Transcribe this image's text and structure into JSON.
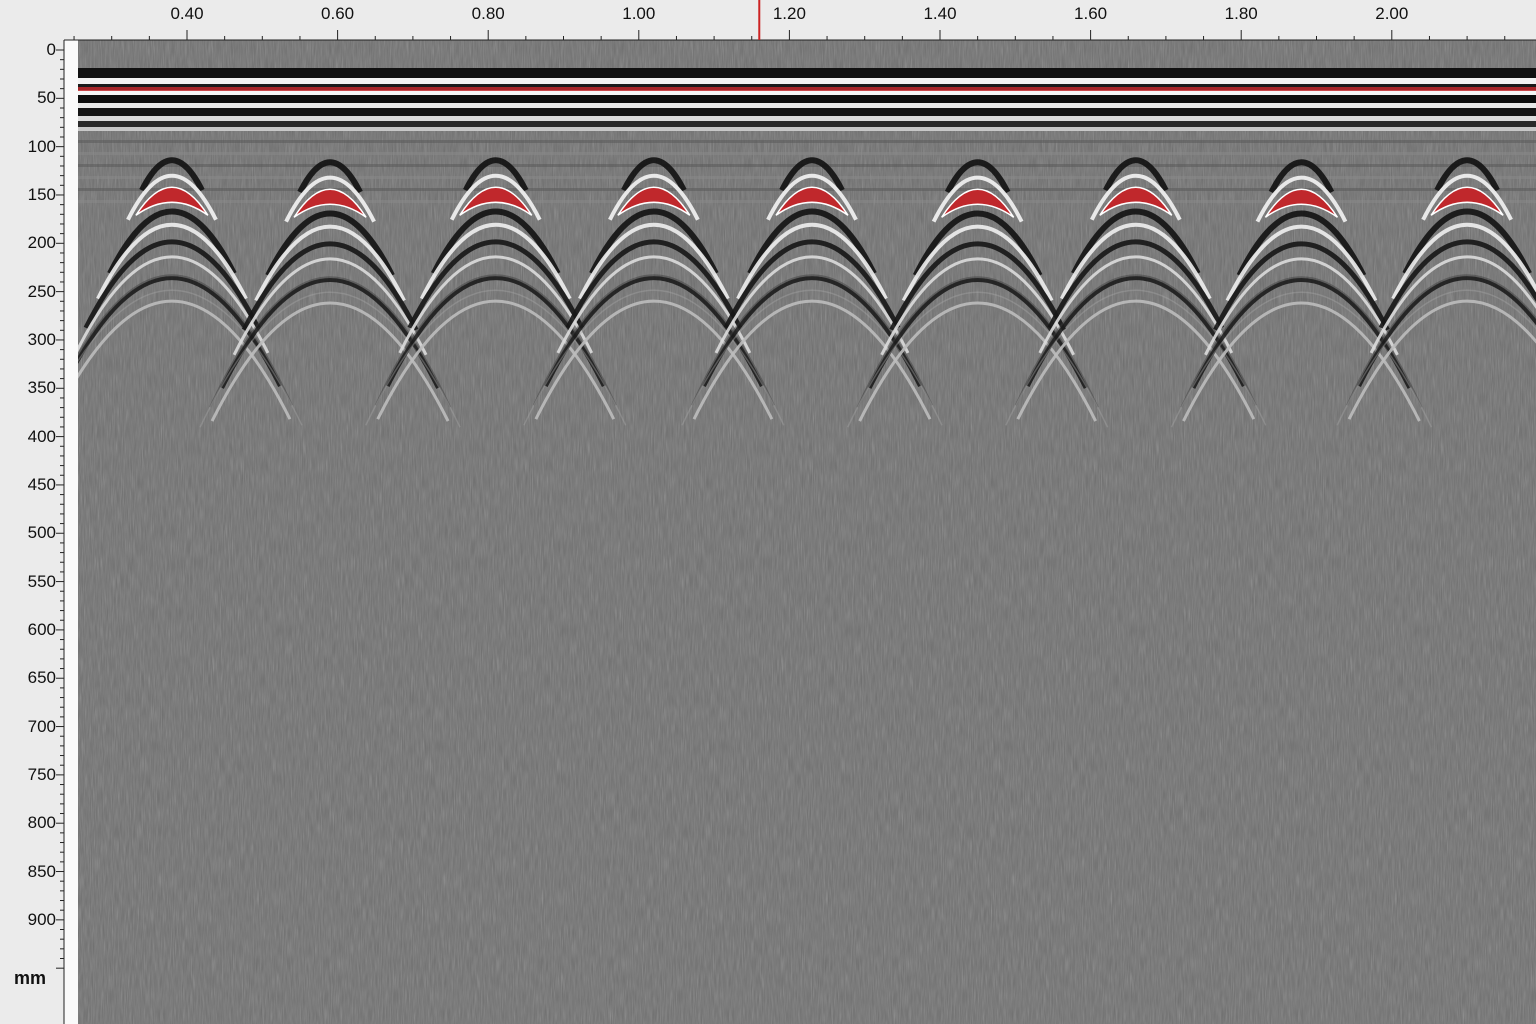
{
  "x_axis": {
    "ticks": [
      {
        "value": 0.4,
        "label": "0.40"
      },
      {
        "value": 0.6,
        "label": "0.60"
      },
      {
        "value": 0.8,
        "label": "0.80"
      },
      {
        "value": 1.0,
        "label": "1.00"
      },
      {
        "value": 1.2,
        "label": "1.20"
      },
      {
        "value": 1.4,
        "label": "1.40"
      },
      {
        "value": 1.6,
        "label": "1.60"
      },
      {
        "value": 1.8,
        "label": "1.80"
      },
      {
        "value": 2.0,
        "label": "2.00"
      }
    ],
    "cursor_value": 1.16
  },
  "y_axis": {
    "unit": "mm",
    "ticks": [
      {
        "value": 0,
        "label": "0"
      },
      {
        "value": 50,
        "label": "50"
      },
      {
        "value": 100,
        "label": "100"
      },
      {
        "value": 150,
        "label": "150"
      },
      {
        "value": 200,
        "label": "200"
      },
      {
        "value": 250,
        "label": "250"
      },
      {
        "value": 300,
        "label": "300"
      },
      {
        "value": 350,
        "label": "350"
      },
      {
        "value": 400,
        "label": "400"
      },
      {
        "value": 450,
        "label": "450"
      },
      {
        "value": 500,
        "label": "500"
      },
      {
        "value": 550,
        "label": "550"
      },
      {
        "value": 600,
        "label": "600"
      },
      {
        "value": 650,
        "label": "650"
      },
      {
        "value": 700,
        "label": "700"
      },
      {
        "value": 750,
        "label": "750"
      },
      {
        "value": 800,
        "label": "800"
      },
      {
        "value": 850,
        "label": "850"
      },
      {
        "value": 900,
        "label": "900"
      }
    ]
  },
  "targets": [
    {
      "x": 0.38,
      "depth": 140
    },
    {
      "x": 0.59,
      "depth": 142
    },
    {
      "x": 0.81,
      "depth": 140
    },
    {
      "x": 1.02,
      "depth": 140
    },
    {
      "x": 1.23,
      "depth": 140
    },
    {
      "x": 1.45,
      "depth": 142
    },
    {
      "x": 1.66,
      "depth": 140
    },
    {
      "x": 1.88,
      "depth": 142
    },
    {
      "x": 2.1,
      "depth": 140
    }
  ],
  "colors": {
    "background": "#6e6e6e",
    "marker": "#c0282c",
    "cursor": "#cc2222",
    "ruler": "#ebebeb"
  }
}
